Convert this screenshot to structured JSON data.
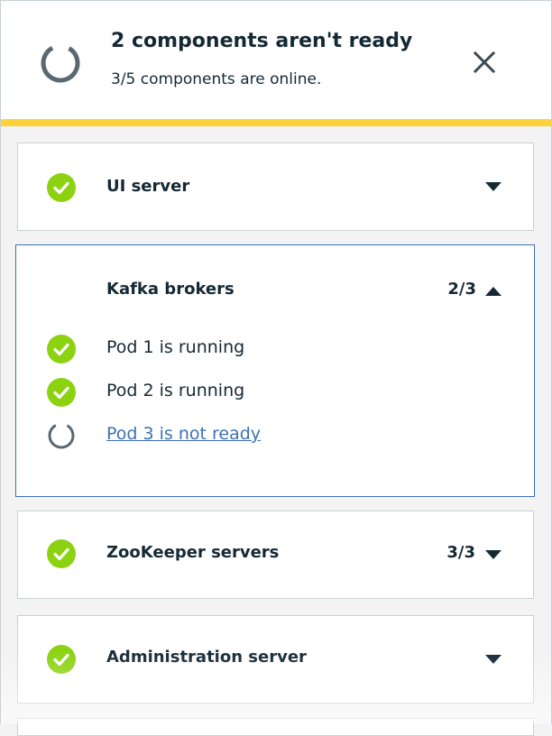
{
  "header": {
    "title": "2 components aren't ready",
    "subtitle": "3/5 components are online.",
    "spinner_icon": "loading-spinner-icon",
    "close_icon": "close-icon"
  },
  "colors": {
    "success": "#8cd211",
    "warning_bar": "#fdd13a",
    "link": "#3d70b2",
    "spinner": "#5a6872",
    "text": "#152935"
  },
  "components": [
    {
      "name": "UI server",
      "count": "",
      "status": "ready",
      "expanded": false
    },
    {
      "name": "Kafka brokers",
      "count": "2/3",
      "status": "pending",
      "expanded": true,
      "pods": [
        {
          "label": "Pod 1 is running",
          "status": "ready"
        },
        {
          "label": "Pod 2 is running",
          "status": "ready"
        },
        {
          "label": "Pod 3 is not ready",
          "status": "pending",
          "link": true
        }
      ]
    },
    {
      "name": "ZooKeeper servers",
      "count": "3/3",
      "status": "ready",
      "expanded": false
    },
    {
      "name": "Administration server",
      "count": "",
      "status": "ready",
      "expanded": false
    }
  ]
}
